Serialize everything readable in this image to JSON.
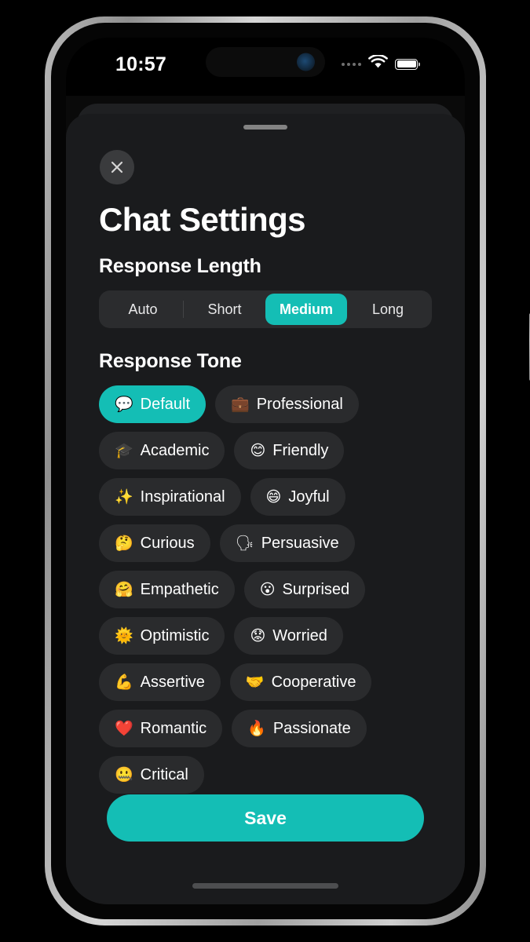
{
  "status_bar": {
    "time": "10:57",
    "signal_icon": "signal-dots-icon",
    "wifi_icon": "wifi-icon",
    "battery_icon": "battery-full-icon"
  },
  "sheet": {
    "grabber": "sheet-grabber",
    "close_icon": "close-icon",
    "title": "Chat Settings"
  },
  "response_length": {
    "heading": "Response Length",
    "options": [
      {
        "label": "Auto",
        "selected": false
      },
      {
        "label": "Short",
        "selected": false
      },
      {
        "label": "Medium",
        "selected": true
      },
      {
        "label": "Long",
        "selected": false
      }
    ],
    "selected_value": "Medium"
  },
  "response_tone": {
    "heading": "Response Tone",
    "selected_value": "Default",
    "chips": [
      {
        "emoji": "💬",
        "label": "Default",
        "selected": true
      },
      {
        "emoji": "💼",
        "label": "Professional",
        "selected": false
      },
      {
        "emoji": "🎓",
        "label": "Academic",
        "selected": false
      },
      {
        "emoji": "😊",
        "label": "Friendly",
        "selected": false
      },
      {
        "emoji": "✨",
        "label": "Inspirational",
        "selected": false
      },
      {
        "emoji": "😄",
        "label": "Joyful",
        "selected": false
      },
      {
        "emoji": "🤔",
        "label": "Curious",
        "selected": false
      },
      {
        "emoji": "🗣",
        "label": "Persuasive",
        "selected": false
      },
      {
        "emoji": "🤗",
        "label": "Empathetic",
        "selected": false
      },
      {
        "emoji": "😮",
        "label": "Surprised",
        "selected": false
      },
      {
        "emoji": "🌞",
        "label": "Optimistic",
        "selected": false
      },
      {
        "emoji": "😟",
        "label": "Worried",
        "selected": false
      },
      {
        "emoji": "💪",
        "label": "Assertive",
        "selected": false
      },
      {
        "emoji": "🤝",
        "label": "Cooperative",
        "selected": false
      },
      {
        "emoji": "❤️",
        "label": "Romantic",
        "selected": false
      },
      {
        "emoji": "🔥",
        "label": "Passionate",
        "selected": false
      },
      {
        "emoji": "🤐",
        "label": "Critical",
        "selected": false
      }
    ]
  },
  "footer": {
    "save_label": "Save",
    "home_indicator": "home-indicator"
  },
  "colors": {
    "accent": "#14beb5",
    "sheet_bg": "#1a1b1d",
    "chip_bg": "#2a2b2d",
    "segment_track": "#2b2c2e"
  }
}
